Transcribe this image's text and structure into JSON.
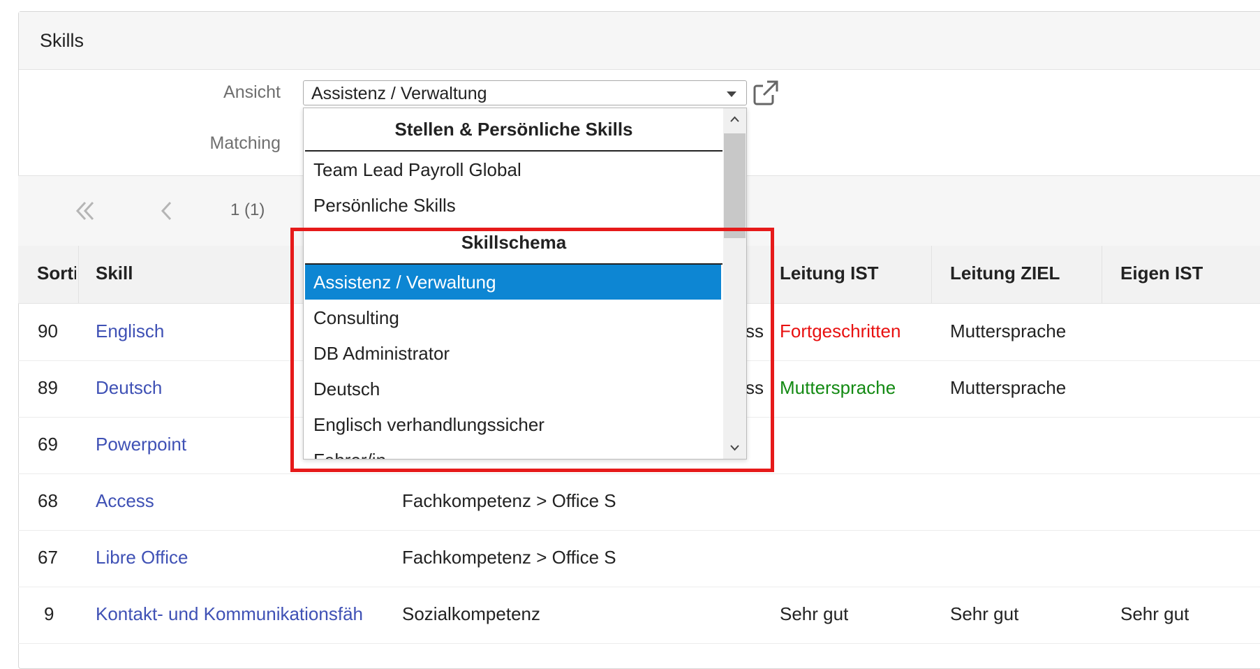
{
  "panel": {
    "title": "Skills"
  },
  "form": {
    "ansicht_label": "Ansicht",
    "matching_label": "Matching",
    "ansicht_value": "Assistenz / Verwaltung"
  },
  "pager": {
    "page_info": "1 (1)"
  },
  "table": {
    "columns": [
      "Sorti",
      "Skill",
      "Leitung IST",
      "Leitung ZIEL",
      "Eigen IST"
    ],
    "rows": [
      {
        "sort": "90",
        "skill": "Englisch",
        "category": "",
        "partial": "ss",
        "leitung_ist": "Fortgeschritten",
        "leitung_ist_color": "#e81010",
        "leitung_ziel": "Muttersprache",
        "eigen_ist": ""
      },
      {
        "sort": "89",
        "skill": "Deutsch",
        "category": "",
        "partial": "ss",
        "leitung_ist": "Muttersprache",
        "leitung_ist_color": "#138a13",
        "leitung_ziel": "Muttersprache",
        "eigen_ist": ""
      },
      {
        "sort": "69",
        "skill": "Powerpoint",
        "category": "",
        "partial": "",
        "leitung_ist": "",
        "leitung_ziel": "",
        "eigen_ist": ""
      },
      {
        "sort": "68",
        "skill": "Access",
        "category": "Fachkompetenz > Office S",
        "partial": "",
        "leitung_ist": "",
        "leitung_ziel": "",
        "eigen_ist": ""
      },
      {
        "sort": "67",
        "skill": "Libre Office",
        "category": "Fachkompetenz > Office S",
        "partial": "",
        "leitung_ist": "",
        "leitung_ziel": "",
        "eigen_ist": ""
      },
      {
        "sort": "9",
        "skill": "Kontakt- und Kommunikationsfäh",
        "category": "Sozialkompetenz",
        "partial": "",
        "leitung_ist": "Sehr gut",
        "leitung_ziel": "Sehr gut",
        "eigen_ist": "Sehr gut"
      }
    ]
  },
  "dropdown": {
    "group1": "Stellen & Persönliche Skills",
    "group1_items": [
      "Team Lead Payroll Global",
      "Persönliche Skills"
    ],
    "group2": "Skillschema",
    "group2_items": [
      "Assistenz / Verwaltung",
      "Consulting",
      "DB Administrator",
      "Deutsch",
      "Englisch verhandlungssicher",
      "Fahrer/in"
    ],
    "selected": "Assistenz / Verwaltung"
  },
  "icons": {
    "external_link": "external-link-icon",
    "first_page": "double-chevron-left-icon",
    "prev_page": "chevron-left-icon",
    "scroll_up": "chevron-up-icon",
    "scroll_down": "chevron-down-icon"
  },
  "colors": {
    "link": "#3f51b5",
    "selected_bg": "#0d86d3",
    "highlight_border": "#e61a1a"
  }
}
